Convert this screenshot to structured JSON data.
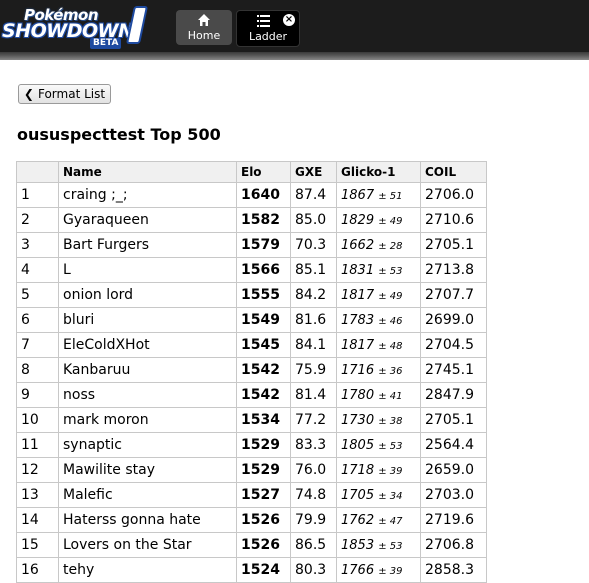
{
  "header": {
    "logo": {
      "line1": "Pokémon",
      "line2": "SHOWDOWN",
      "badge": "BETA"
    },
    "tabs": [
      {
        "label": "Home",
        "icon": "home-icon"
      },
      {
        "label": "Ladder",
        "icon": "list-icon"
      }
    ]
  },
  "format_button": {
    "label": "Format List"
  },
  "title": "oususpecttest Top 500",
  "table": {
    "columns": [
      "",
      "Name",
      "Elo",
      "GXE",
      "Glicko-1",
      "COIL"
    ],
    "rows": [
      {
        "rank": "1",
        "name": "craing ;_;",
        "elo": "1640",
        "gxe": "87.4",
        "glicko": "1867",
        "glicko_dev": "± 51",
        "coil": "2706.0"
      },
      {
        "rank": "2",
        "name": "Gyaraqueen",
        "elo": "1582",
        "gxe": "85.0",
        "glicko": "1829",
        "glicko_dev": "± 49",
        "coil": "2710.6"
      },
      {
        "rank": "3",
        "name": "Bart Furgers",
        "elo": "1579",
        "gxe": "70.3",
        "glicko": "1662",
        "glicko_dev": "± 28",
        "coil": "2705.1"
      },
      {
        "rank": "4",
        "name": "L",
        "elo": "1566",
        "gxe": "85.1",
        "glicko": "1831",
        "glicko_dev": "± 53",
        "coil": "2713.8"
      },
      {
        "rank": "5",
        "name": "onion lord",
        "elo": "1555",
        "gxe": "84.2",
        "glicko": "1817",
        "glicko_dev": "± 49",
        "coil": "2707.7"
      },
      {
        "rank": "6",
        "name": "bluri",
        "elo": "1549",
        "gxe": "81.6",
        "glicko": "1783",
        "glicko_dev": "± 46",
        "coil": "2699.0"
      },
      {
        "rank": "7",
        "name": "EleColdXHot",
        "elo": "1545",
        "gxe": "84.1",
        "glicko": "1817",
        "glicko_dev": "± 48",
        "coil": "2704.5"
      },
      {
        "rank": "8",
        "name": "Kanbaruu",
        "elo": "1542",
        "gxe": "75.9",
        "glicko": "1716",
        "glicko_dev": "± 36",
        "coil": "2745.1"
      },
      {
        "rank": "9",
        "name": "noss",
        "elo": "1542",
        "gxe": "81.4",
        "glicko": "1780",
        "glicko_dev": "± 41",
        "coil": "2847.9"
      },
      {
        "rank": "10",
        "name": "mark moron",
        "elo": "1534",
        "gxe": "77.2",
        "glicko": "1730",
        "glicko_dev": "± 38",
        "coil": "2705.1"
      },
      {
        "rank": "11",
        "name": "synaptic",
        "elo": "1529",
        "gxe": "83.3",
        "glicko": "1805",
        "glicko_dev": "± 53",
        "coil": "2564.4"
      },
      {
        "rank": "12",
        "name": "Mawilite stay",
        "elo": "1529",
        "gxe": "76.0",
        "glicko": "1718",
        "glicko_dev": "± 39",
        "coil": "2659.0"
      },
      {
        "rank": "13",
        "name": "Malefic",
        "elo": "1527",
        "gxe": "74.8",
        "glicko": "1705",
        "glicko_dev": "± 34",
        "coil": "2703.0"
      },
      {
        "rank": "14",
        "name": "Haterss gonna hate",
        "elo": "1526",
        "gxe": "79.9",
        "glicko": "1762",
        "glicko_dev": "± 47",
        "coil": "2719.6"
      },
      {
        "rank": "15",
        "name": "Lovers on the Star",
        "elo": "1526",
        "gxe": "86.5",
        "glicko": "1853",
        "glicko_dev": "± 53",
        "coil": "2706.8"
      },
      {
        "rank": "16",
        "name": "tehy",
        "elo": "1524",
        "gxe": "80.3",
        "glicko": "1766",
        "glicko_dev": "± 39",
        "coil": "2858.3"
      }
    ]
  }
}
